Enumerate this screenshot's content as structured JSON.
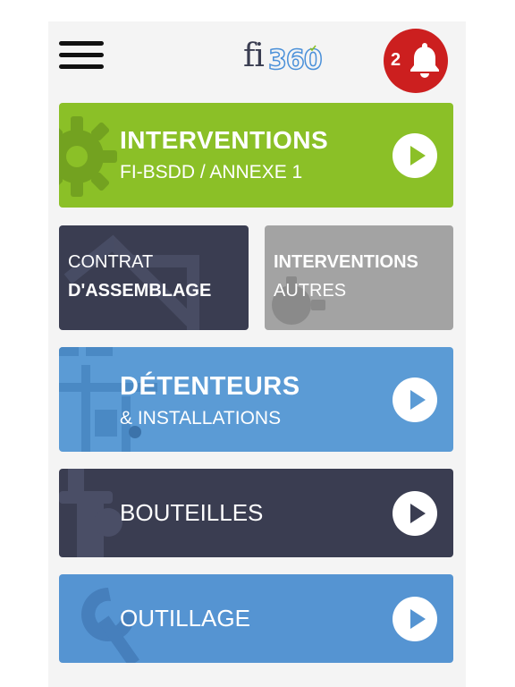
{
  "header": {
    "logo_prefix": "fi",
    "logo_number": "360",
    "notifications_count": "2"
  },
  "tiles": {
    "interventions": {
      "title": "INTERVENTIONS",
      "subtitle": "FI-BSDD / ANNEXE 1",
      "color": "#8bc027"
    },
    "contrat": {
      "line1": "CONTRAT",
      "line2": "D'ASSEMBLAGE",
      "color": "#3a3d51"
    },
    "interventions_autres": {
      "line1": "INTERVENTIONS",
      "line2": "AUTRES",
      "color": "#a3a3a3"
    },
    "detenteurs": {
      "title": "DÉTENTEURS",
      "subtitle": "& INSTALLATIONS",
      "color": "#5b9bd5"
    },
    "bouteilles": {
      "title": "BOUTEILLES",
      "color": "#3a3d51"
    },
    "outillage": {
      "title": "OUTILLAGE",
      "color": "#5594d2"
    }
  },
  "icons": {
    "menu": "hamburger-icon",
    "bell": "bell-icon",
    "play": "play-icon",
    "gear": "gear-icon",
    "wrench": "wrench-icon",
    "map": "map-icon"
  },
  "accent_colors": {
    "notification": "#cc1f1f"
  }
}
